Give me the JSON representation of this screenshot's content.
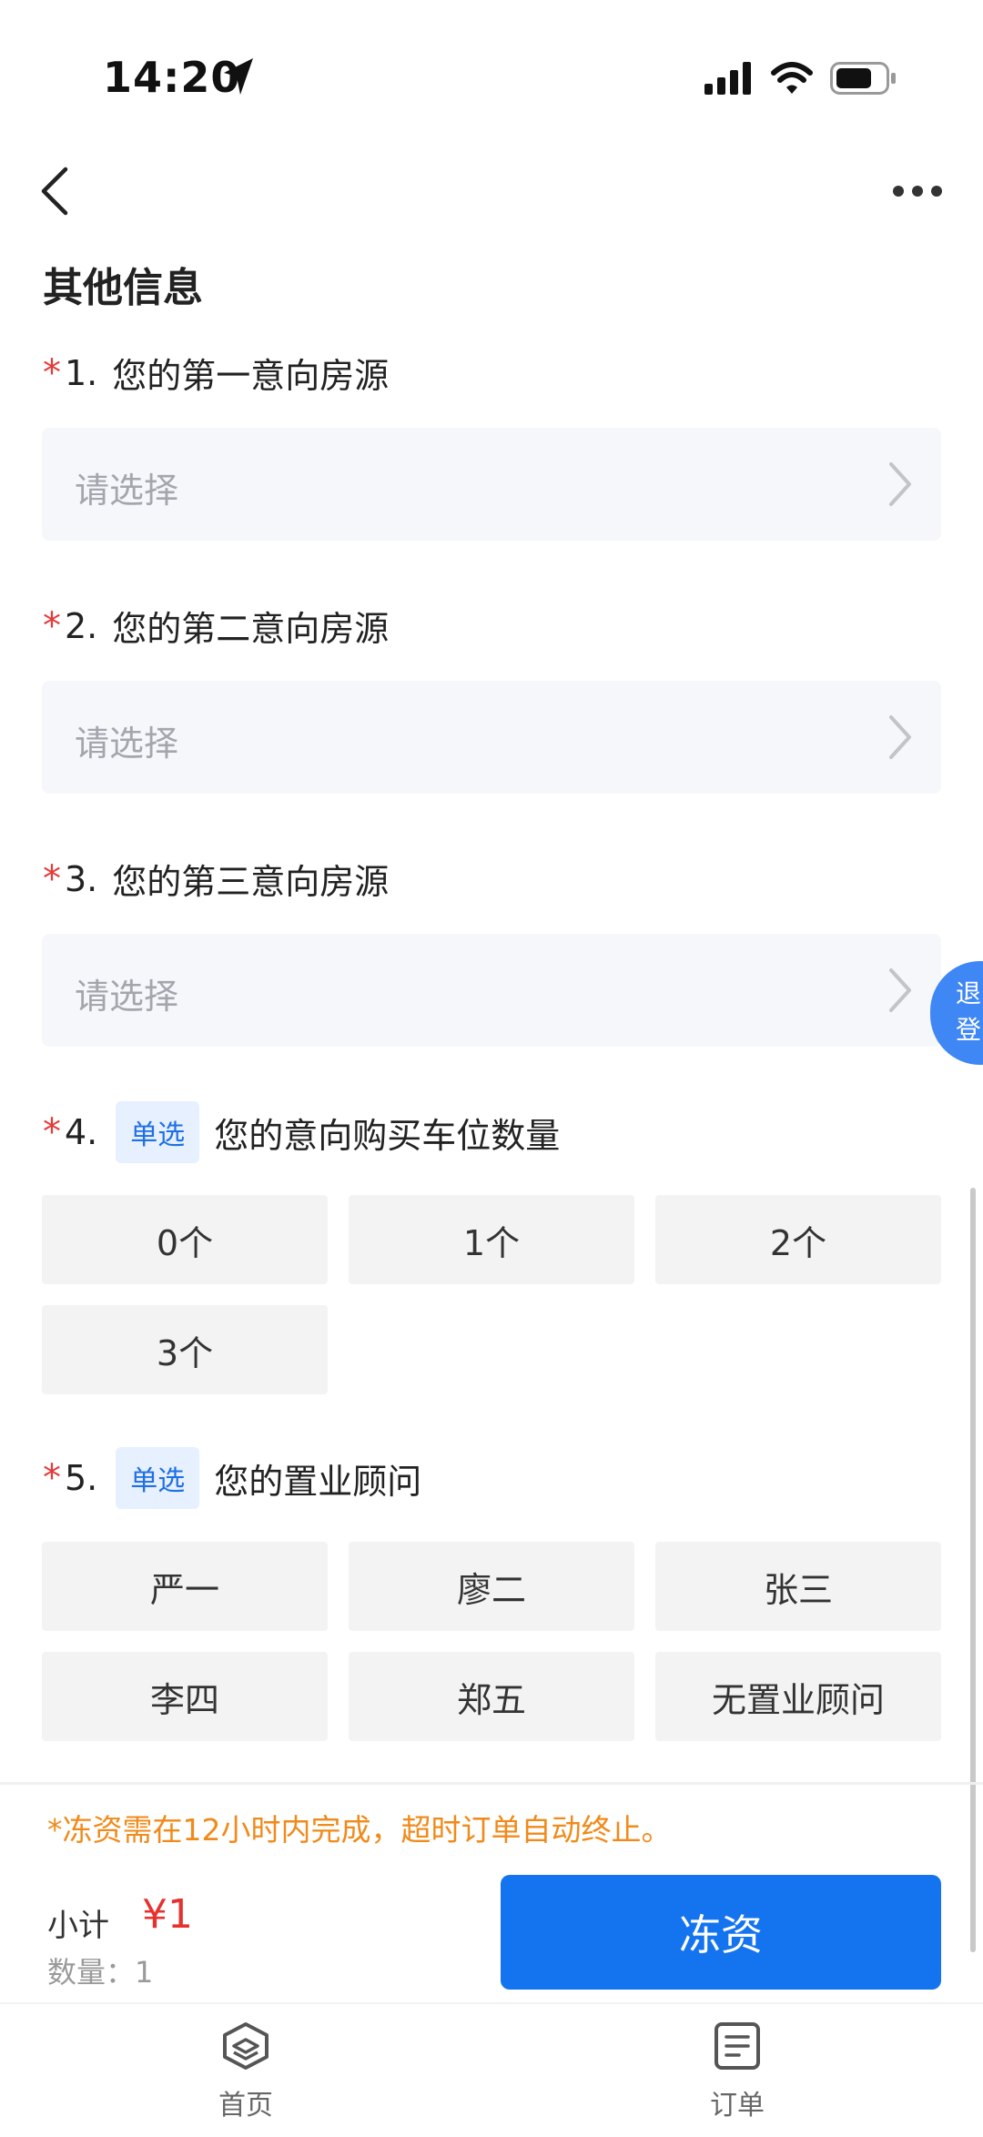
{
  "status": {
    "time": "14:20"
  },
  "section_title": "其他信息",
  "questions": [
    {
      "req": "*",
      "num": "1.",
      "title": "您的第一意向房源",
      "placeholder": "请选择"
    },
    {
      "req": "*",
      "num": "2.",
      "title": "您的第二意向房源",
      "placeholder": "请选择"
    },
    {
      "req": "*",
      "num": "3.",
      "title": "您的第三意向房源",
      "placeholder": "请选择"
    },
    {
      "req": "*",
      "num": "4.",
      "tag": "单选",
      "title": "您的意向购买车位数量",
      "options": [
        "0个",
        "1个",
        "2个",
        "3个"
      ]
    },
    {
      "req": "*",
      "num": "5.",
      "tag": "单选",
      "title": "您的置业顾问",
      "options": [
        "严一",
        "廖二",
        "张三",
        "李四",
        "郑五",
        "无置业顾问"
      ]
    }
  ],
  "floating_tab": {
    "line1": "退",
    "line2": "登"
  },
  "footer": {
    "notice": "*冻资需在12小时内完成，超时订单自动终止。",
    "subtotal_label": "小计",
    "price": "¥1",
    "quantity": "数量：1",
    "button": "冻资"
  },
  "tabbar": [
    {
      "label": "首页",
      "icon": "home-cube-icon"
    },
    {
      "label": "订单",
      "icon": "orders-document-icon"
    }
  ],
  "colors": {
    "accent": "#1473ee",
    "required": "#e63a3a",
    "notice": "#f08a1a",
    "price": "#e6322e"
  }
}
